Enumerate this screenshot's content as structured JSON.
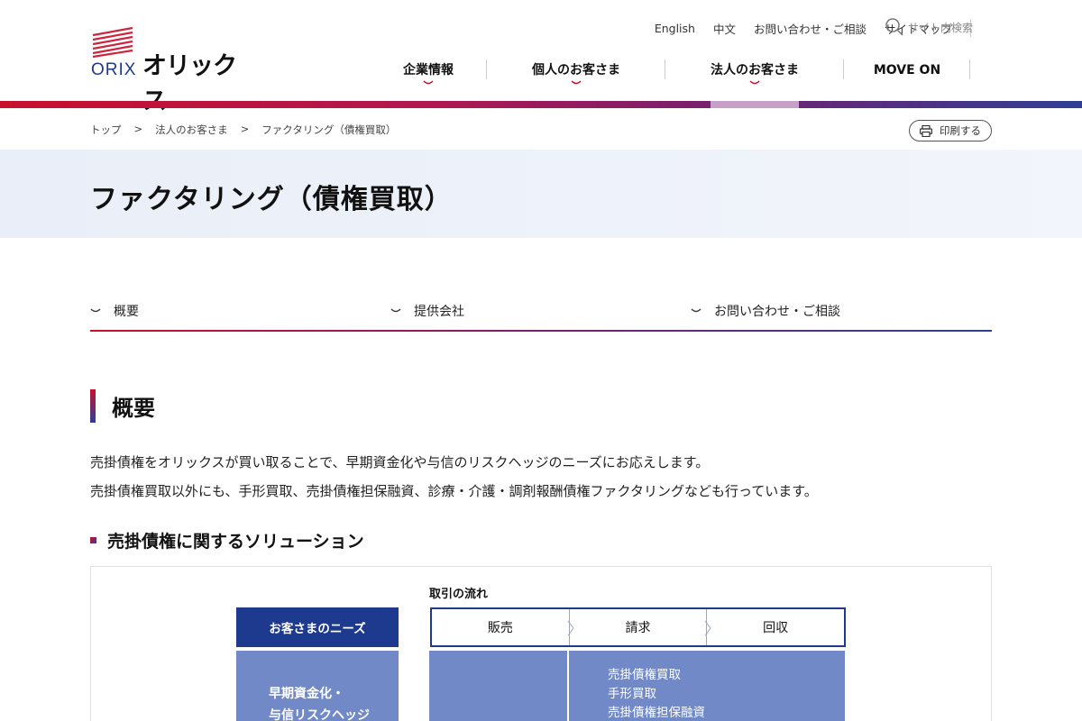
{
  "brand": {
    "logo_latin": "ORIX",
    "logo_kana": "オリックス"
  },
  "utility_nav": [
    "English",
    "中文",
    "お問い合わせ・ご相談",
    "サイトマップ"
  ],
  "search": {
    "placeholder": "サイト内検索"
  },
  "main_nav": [
    {
      "label": "企業情報"
    },
    {
      "label": "個人のお客さま"
    },
    {
      "label": "法人のお客さま"
    },
    {
      "label": "MOVE ON"
    }
  ],
  "breadcrumb": [
    "トップ",
    ">",
    "法人のお客さま",
    ">",
    "ファクタリング（債権買取）"
  ],
  "print_label": "印刷する",
  "page_title": "ファクタリング（債権買取）",
  "anchors": [
    "概要",
    "提供会社",
    "お問い合わせ・ご相談"
  ],
  "overview": {
    "heading": "概要",
    "paragraphs": [
      "売掛債権をオリックスが買い取ることで、早期資金化や与信のリスクヘッジのニーズにお応えします。",
      "売掛債権買取以外にも、手形買取、売掛債権担保融資、診療・介護・調剤報酬債権ファクタリングなども行っています。"
    ]
  },
  "solutions": {
    "heading": "売掛債権に関するソリューション",
    "flow_title": "取引の流れ",
    "needs_header": "お客さまのニーズ",
    "steps": [
      "販売",
      "請求",
      "回収"
    ],
    "needs_lines": [
      "早期資金化・",
      "与信リスクヘッジ"
    ],
    "solution_lines": [
      "売掛債権買取",
      "手形買取",
      "売掛債権担保融資"
    ]
  },
  "colors": {
    "brand_red": "#c8102e",
    "brand_navy": "#1d3a8f",
    "diagram_fill": "#7189c6"
  }
}
